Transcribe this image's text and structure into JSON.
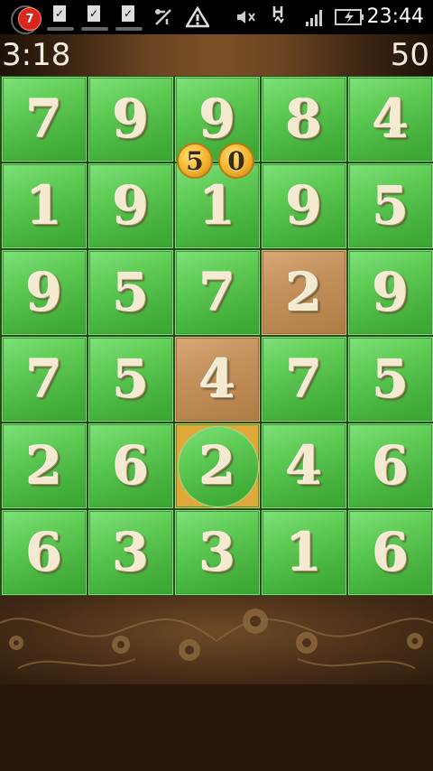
{
  "status_bar": {
    "notification_count": "7",
    "time": "23:44",
    "icons": [
      "notification-badge-icon",
      "file-check-icon",
      "file-check-icon",
      "file-check-icon",
      "usb-debug-icon",
      "warning-icon",
      "mute-icon",
      "hspa-data-icon",
      "signal-icon",
      "battery-charging-icon"
    ]
  },
  "game": {
    "timer": "3:18",
    "score": "50",
    "popup_points": [
      "5",
      "0"
    ],
    "board": [
      [
        "7",
        "9",
        "9",
        "8",
        "4"
      ],
      [
        "1",
        "9",
        "1",
        "9",
        "5"
      ],
      [
        "9",
        "5",
        "7",
        "2",
        "9"
      ],
      [
        "7",
        "5",
        "4",
        "7",
        "5"
      ],
      [
        "2",
        "6",
        "2",
        "4",
        "6"
      ],
      [
        "6",
        "3",
        "3",
        "1",
        "6"
      ]
    ],
    "selected_tiles": [
      [
        2,
        3
      ],
      [
        3,
        2
      ]
    ],
    "cursor_tile": [
      4,
      2
    ],
    "colors": {
      "tile_green": "#5fcb55",
      "tile_selected": "#c4915c",
      "cursor_gold": "#e0a93a",
      "digit_cream": "#f4ead0"
    }
  }
}
